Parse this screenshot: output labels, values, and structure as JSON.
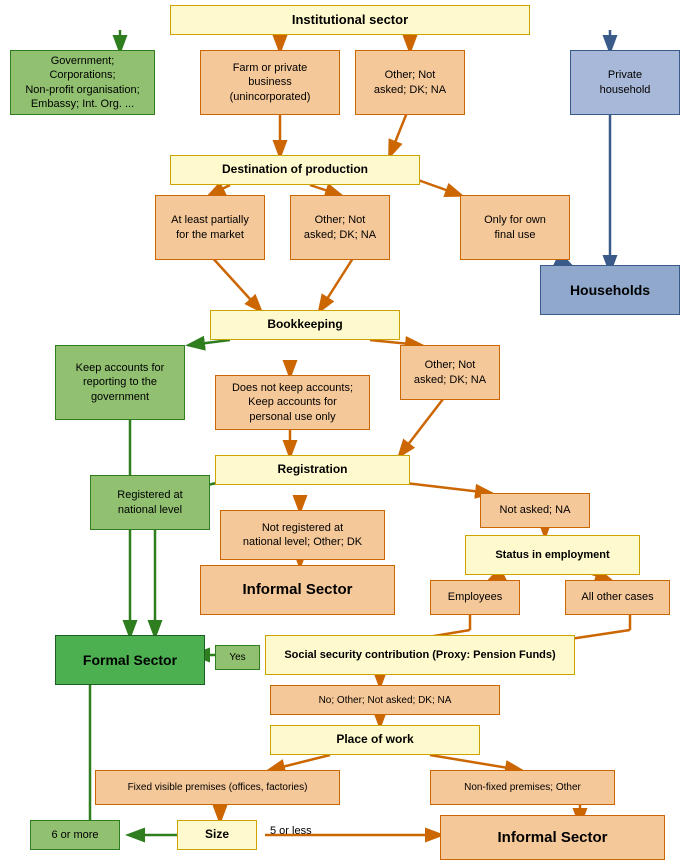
{
  "boxes": {
    "institutional_sector": "Institutional sector",
    "gov_corp": "Government; Corporations;\nNon-profit organisation;\nEmbassy; Int. Org. ...",
    "farm_business": "Farm or private\nbusiness\n(unincorporated)",
    "other_not_asked1": "Other; Not\nasked; DK; NA",
    "private_household": "Private\nhousehold",
    "destination": "Destination of production",
    "at_least_partially": "At least partially\nfor the market",
    "other_not_asked2": "Other; Not\nasked; DK; NA",
    "only_own_use": "Only for own\nfinal use",
    "households": "Households",
    "bookkeeping": "Bookkeeping",
    "keep_accounts": "Keep accounts for\nreporting to the\ngovernment",
    "does_not_keep": "Does not keep accounts;\nKeep accounts for\npersonal use only",
    "other_not_asked3": "Other; Not\nasked; DK; NA",
    "registration": "Registration",
    "registered_national": "Registered at\nnational level",
    "not_registered": "Not registered at\nnational level; Other; DK",
    "not_asked_na": "Not asked; NA",
    "informal_sector1": "Informal Sector",
    "status_employment": "Status in employment",
    "employees": "Employees",
    "all_other_cases": "All other cases",
    "formal_sector": "Formal Sector",
    "yes": "Yes",
    "social_security": "Social security contribution (Proxy: Pension Funds)",
    "no_other": "No; Other; Not asked; DK; NA",
    "place_of_work": "Place of work",
    "fixed_premises": "Fixed visible premises (offices, factories)",
    "non_fixed": "Non-fixed premises; Other",
    "size": "Size",
    "six_or_more": "6 or more",
    "five_or_less": "5 or less",
    "informal_sector2": "Informal Sector"
  }
}
